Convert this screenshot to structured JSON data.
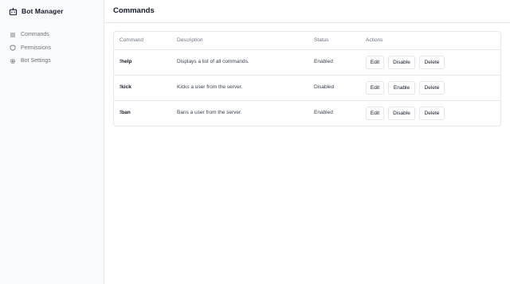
{
  "app": {
    "title": "Bot Manager",
    "icon": "robot-icon"
  },
  "sidebar": {
    "items": [
      {
        "label": "Commands",
        "icon": "list-icon"
      },
      {
        "label": "Permissions",
        "icon": "shield-icon"
      },
      {
        "label": "Bot Settings",
        "icon": "gear-icon"
      }
    ]
  },
  "page": {
    "title": "Commands"
  },
  "table": {
    "headers": [
      "Command",
      "Description",
      "Status",
      "Actions"
    ],
    "rows": [
      {
        "command": "!help",
        "description": "Displays a list of all commands.",
        "status": "Enabled",
        "edit": "Edit",
        "toggle": "Disable",
        "delete": "Delete"
      },
      {
        "command": "!kick",
        "description": "Kicks a user from the server.",
        "status": "Disabled",
        "edit": "Edit",
        "toggle": "Enable",
        "delete": "Delete"
      },
      {
        "command": "!ban",
        "description": "Bans a user from the server.",
        "status": "Enabled",
        "edit": "Edit",
        "toggle": "Disable",
        "delete": "Delete"
      }
    ]
  },
  "colors": {
    "sidebar_bg": "#f9fafb",
    "border": "#e5e7eb",
    "muted_text": "#6b7280",
    "text": "#111827"
  }
}
